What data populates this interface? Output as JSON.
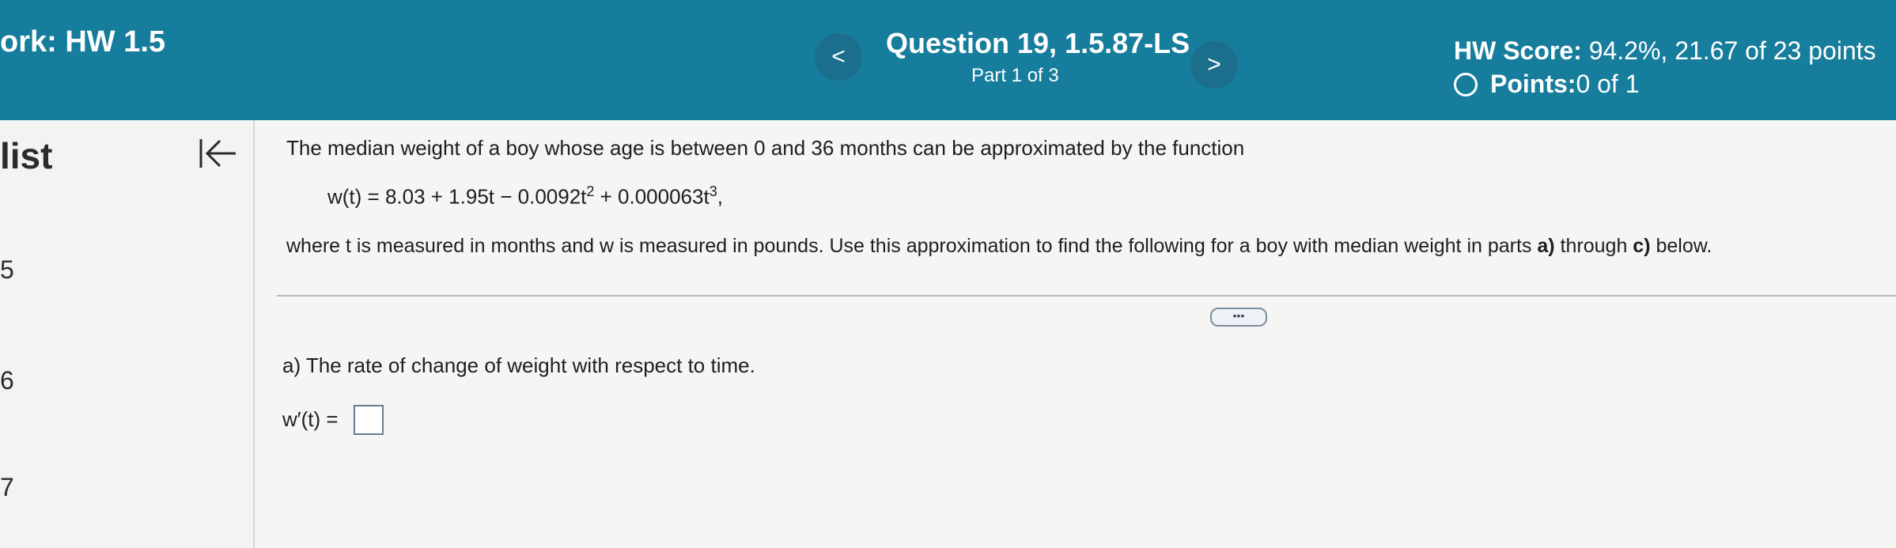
{
  "header": {
    "hw_title": "ork:  HW 1.5",
    "question_title": "Question 19, 1.5.87-LS",
    "part": "Part 1 of 3",
    "prev_label": "<",
    "next_label": ">",
    "score_label": "HW Score:",
    "score_value": " 94.2%, 21.67 of 23 points",
    "points_label": "Points:",
    "points_value": " 0 of 1"
  },
  "sidebar": {
    "heading": "list",
    "numbers": [
      "5",
      "6",
      "7"
    ]
  },
  "question": {
    "intro": "The median weight of a boy whose age is between 0 and 36 months can be approximated by the function",
    "formula_a": "w(t) = 8.03 + 1.95t − 0.0092t",
    "exp_1": "2",
    "formula_b": " + 0.000063t",
    "exp_2": "3",
    "formula_c": ",",
    "explanation_a": "where t is measured in months and w is measured in pounds. Use this approximation to find the following for a boy with median weight in parts ",
    "bold_a": "a)",
    "explanation_b": " through ",
    "bold_c": "c)",
    "explanation_c": " below.",
    "more_label": "•••",
    "part_a": "a) The rate of change of weight with respect to time.",
    "answer_label": "w′(t) ="
  },
  "colors": {
    "header_bg": "#177d9c",
    "content_bg": "#f5f5f3"
  }
}
